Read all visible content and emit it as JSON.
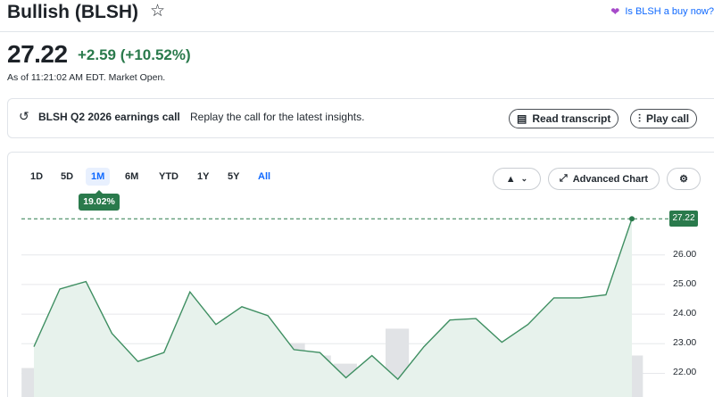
{
  "header": {
    "title": "Bullish (BLSH)",
    "buy_now": "Is BLSH a buy now?"
  },
  "quote": {
    "price": "27.22",
    "change": "+2.59",
    "change_pct": "(+10.52%)",
    "as_of": "As of 11:21:02 AM EDT. Market Open."
  },
  "earnings": {
    "title": "BLSH Q2 2026 earnings call",
    "subtitle": "Replay the call for the latest insights.",
    "read_transcript": "Read transcript",
    "play_call": "Play call"
  },
  "chart_controls": {
    "ranges": [
      "1D",
      "5D",
      "1M",
      "6M",
      "YTD",
      "1Y",
      "5Y",
      "All"
    ],
    "active_range": "1M",
    "range_return": "19.02%",
    "advanced_chart": "Advanced Chart"
  },
  "chart_data": {
    "type": "line",
    "last_price_label": "27.22",
    "y_ticks": [
      "26.00",
      "25.00",
      "24.00",
      "23.00",
      "22.00"
    ],
    "ylim": [
      21.2,
      27.5
    ],
    "prices": [
      22.9,
      24.85,
      25.1,
      23.35,
      22.4,
      22.7,
      24.75,
      23.65,
      24.25,
      23.95,
      22.8,
      22.7,
      21.85,
      22.6,
      21.8,
      22.9,
      23.8,
      23.85,
      23.05,
      23.65,
      24.55,
      24.55,
      24.65,
      27.22
    ],
    "volumes": [
      0.35,
      0.45,
      0.32,
      0.35,
      0.38,
      0.38,
      0.45,
      0.33,
      0.42,
      0.68,
      0.75,
      0.55,
      0.42,
      0.35,
      0.98,
      0.48,
      0.28,
      0.25,
      0.22,
      0.35,
      0.3,
      0.32,
      0.42,
      0.55
    ],
    "grid": true
  },
  "colors": {
    "up": "#2a7a4c",
    "line": "#3f8f62",
    "area": "#e7f2ec",
    "volume": "#e1e3e6",
    "link": "#0f69ff"
  }
}
